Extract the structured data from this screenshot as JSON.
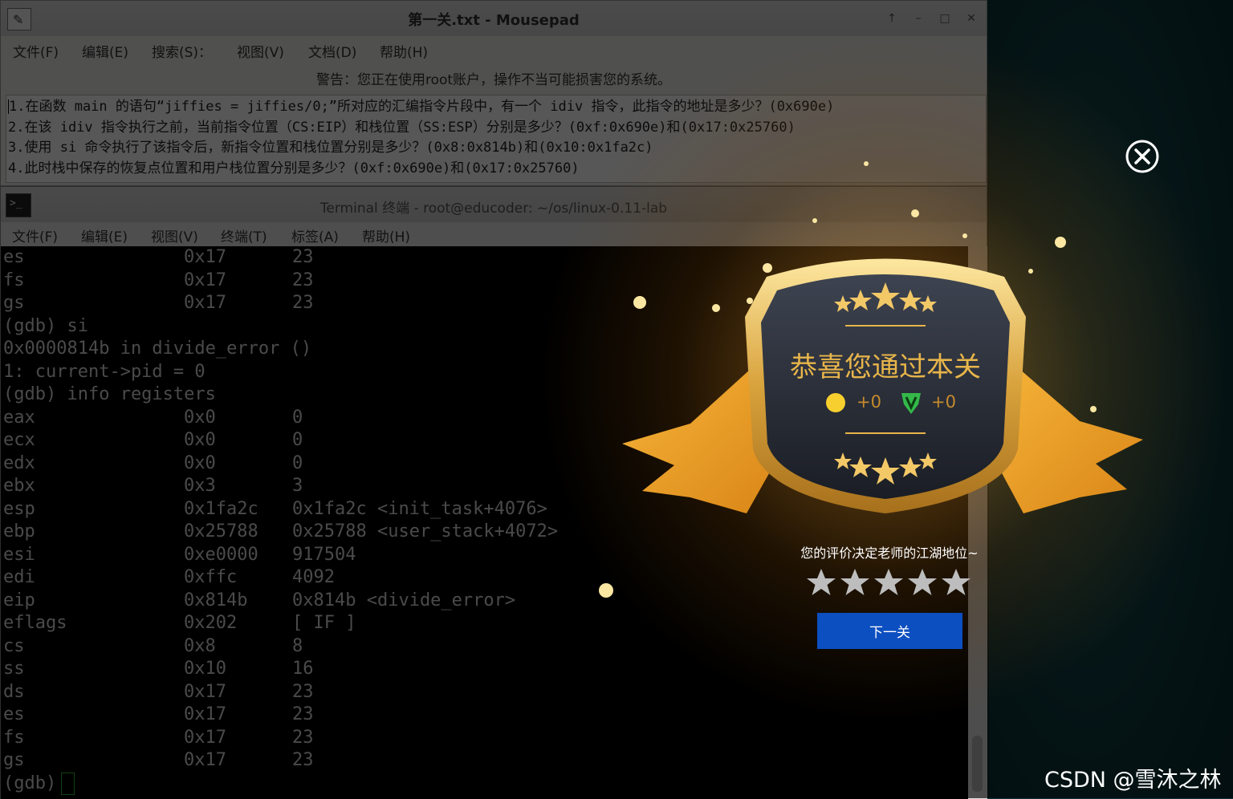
{
  "mousepad": {
    "title": "第一关.txt - Mousepad",
    "menu": [
      "文件(F)",
      "编辑(E)",
      "搜索(S)：",
      "视图(V)",
      "文档(D)",
      "帮助(H)"
    ],
    "warning": "警告：您正在使用root账户，操作不当可能损害您的系统。",
    "lines": [
      "1.在函数 main 的语句“jiffies = jiffies/0;”所对应的汇编指令片段中，有一个 idiv 指令，此指令的地址是多少？(0x690e)",
      "2.在该 idiv 指令执行之前，当前指令位置（CS:EIP）和栈位置（SS:ESP）分别是多少？(0xf:0x690e)和(0x17:0x25760)",
      "3.使用 si 命令执行了该指令后，新指令位置和栈位置分别是多少？(0x8:0x814b)和(0x10:0x1fa2c)",
      "4.此时栈中保存的恢复点位置和用户栈位置分别是多少？(0xf:0x690e)和(0x17:0x25760)"
    ]
  },
  "terminal": {
    "title": "Terminal 终端 - root@educoder: ~/os/linux-0.11-lab",
    "menu": [
      "文件(F)",
      "编辑(E)",
      "视图(V)",
      "终端(T)",
      "标签(A)",
      "帮助(H)"
    ],
    "icon_label": ">_",
    "rows": [
      [
        "es",
        "0x17",
        "23"
      ],
      [
        "fs",
        "0x17",
        "23"
      ],
      [
        "gs",
        "0x17",
        "23"
      ],
      [
        "(gdb) si",
        "",
        ""
      ],
      [
        "0x0000814b in divide_error ()",
        "",
        ""
      ],
      [
        "1: current->pid = 0",
        "",
        ""
      ],
      [
        "(gdb) info registers",
        "",
        ""
      ],
      [
        "eax",
        "0x0",
        "0"
      ],
      [
        "ecx",
        "0x0",
        "0"
      ],
      [
        "edx",
        "0x0",
        "0"
      ],
      [
        "ebx",
        "0x3",
        "3"
      ],
      [
        "esp",
        "0x1fa2c",
        "0x1fa2c <init_task+4076>"
      ],
      [
        "ebp",
        "0x25788",
        "0x25788 <user_stack+4072>"
      ],
      [
        "esi",
        "0xe0000",
        "917504"
      ],
      [
        "edi",
        "0xffc",
        "4092"
      ],
      [
        "eip",
        "0x814b",
        "0x814b <divide_error>"
      ],
      [
        "eflags",
        "0x202",
        "[ IF ]"
      ],
      [
        "cs",
        "0x8",
        "8"
      ],
      [
        "ss",
        "0x10",
        "16"
      ],
      [
        "ds",
        "0x17",
        "23"
      ],
      [
        "es",
        "0x17",
        "23"
      ],
      [
        "fs",
        "0x17",
        "23"
      ],
      [
        "gs",
        "0x17",
        "23"
      ]
    ],
    "prompt": "(gdb)"
  },
  "popup": {
    "congrats": "恭喜您通过本关",
    "coin_score": "+0",
    "v_score": "+0",
    "rating_prompt": "您的评价决定老师的江湖地位~",
    "star_count": 5,
    "next_button": "下一关",
    "colors": {
      "button": "#0c4fc0",
      "gold": "#e8b54a",
      "ribbon": "#f0a12a"
    }
  },
  "watermark": "CSDN @雪沐之林"
}
